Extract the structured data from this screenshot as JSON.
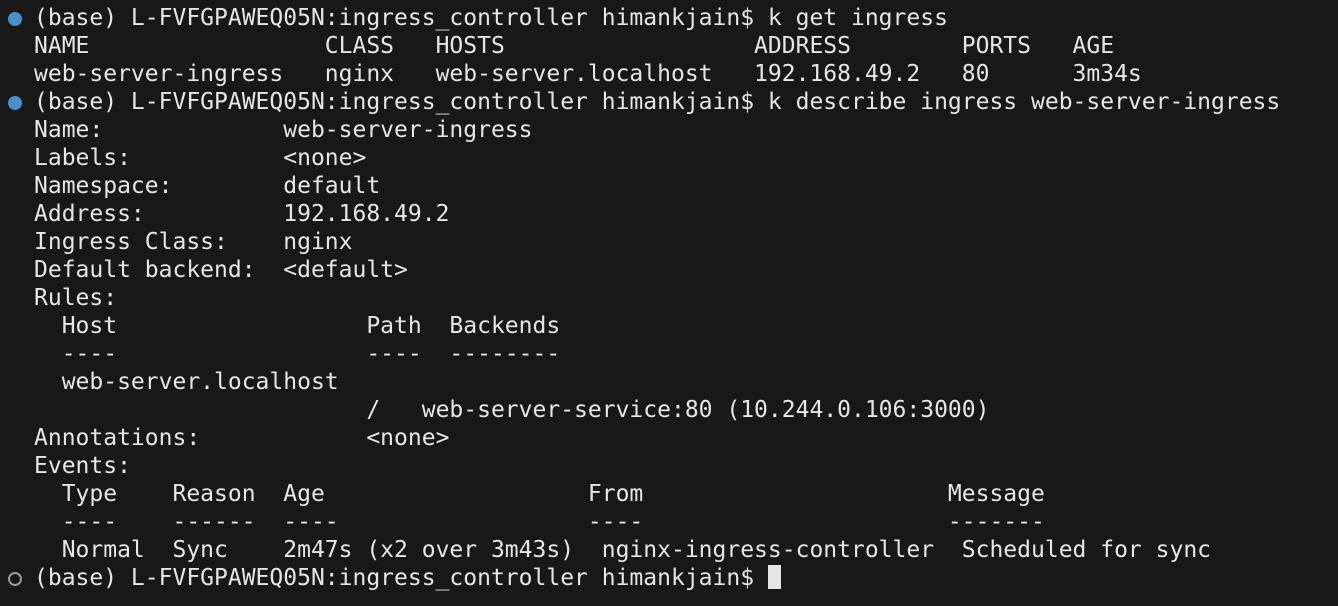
{
  "terminal": {
    "lines": [
      {
        "marker": "done",
        "text": "(base) L-FVFGPAWEQ05N:ingress_controller himankjain$ k get ingress"
      },
      {
        "marker": "",
        "text": "NAME                 CLASS   HOSTS                  ADDRESS        PORTS   AGE"
      },
      {
        "marker": "",
        "text": "web-server-ingress   nginx   web-server.localhost   192.168.49.2   80      3m34s"
      },
      {
        "marker": "done",
        "text": "(base) L-FVFGPAWEQ05N:ingress_controller himankjain$ k describe ingress web-server-ingress"
      },
      {
        "marker": "",
        "text": "Name:             web-server-ingress"
      },
      {
        "marker": "",
        "text": "Labels:           <none>"
      },
      {
        "marker": "",
        "text": "Namespace:        default"
      },
      {
        "marker": "",
        "text": "Address:          192.168.49.2"
      },
      {
        "marker": "",
        "text": "Ingress Class:    nginx"
      },
      {
        "marker": "",
        "text": "Default backend:  <default>"
      },
      {
        "marker": "",
        "text": "Rules:"
      },
      {
        "marker": "",
        "text": "  Host                  Path  Backends"
      },
      {
        "marker": "",
        "text": "  ----                  ----  --------"
      },
      {
        "marker": "",
        "text": "  web-server.localhost"
      },
      {
        "marker": "",
        "text": "                        /   web-server-service:80 (10.244.0.106:3000)"
      },
      {
        "marker": "",
        "text": "Annotations:            <none>"
      },
      {
        "marker": "",
        "text": "Events:"
      },
      {
        "marker": "",
        "text": "  Type    Reason  Age                   From                      Message"
      },
      {
        "marker": "",
        "text": "  ----    ------  ----                  ----                      -------"
      },
      {
        "marker": "",
        "text": "  Normal  Sync    2m47s (x2 over 3m43s)  nginx-ingress-controller  Scheduled for sync"
      }
    ],
    "prompt": {
      "marker": "pending",
      "text": "(base) L-FVFGPAWEQ05N:ingress_controller himankjain$ "
    },
    "colors": {
      "background": "#181818",
      "text": "#e6e6e6",
      "success_marker": "#4a90c8",
      "pending_marker": "#9a9a9a"
    }
  }
}
